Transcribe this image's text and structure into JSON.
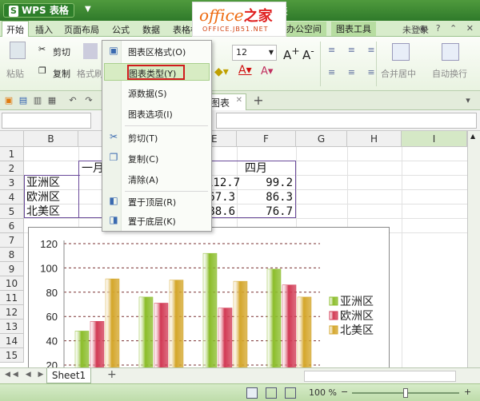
{
  "titlebar": {
    "app_name": "WPS 表格",
    "logo_letter": "S",
    "window_suffix": "表",
    "watermark_main": "office",
    "watermark_cn": "之家",
    "watermark_sub": "OFFICE.JB51.NET"
  },
  "menu_tabs": [
    "开始",
    "插入",
    "页面布局",
    "公式",
    "数据",
    "表格样式",
    "办公空间",
    "图表工具"
  ],
  "login_label": "未登录",
  "ribbon": {
    "cut_label": "剪切",
    "copy_label": "复制",
    "paste_label": "粘贴",
    "format_painter_label": "格式刷",
    "font_size": "12",
    "merge_label": "合并居中",
    "wrap_label": "自动换行"
  },
  "doc_tab_label": "图表",
  "context_menu": {
    "items": [
      {
        "label": "图表区格式(O)",
        "icon": "chart-format-icon"
      },
      {
        "label": "图表类型(Y)",
        "icon": ""
      },
      {
        "label": "源数据(S)",
        "icon": ""
      },
      {
        "label": "图表选项(I)",
        "icon": ""
      },
      {
        "label": "剪切(T)",
        "icon": "scissors-icon"
      },
      {
        "label": "复制(C)",
        "icon": "copy-icon"
      },
      {
        "label": "清除(A)",
        "icon": ""
      },
      {
        "label": "置于顶层(R)",
        "icon": "bring-front-icon"
      },
      {
        "label": "置于底层(K)",
        "icon": "send-back-icon"
      }
    ]
  },
  "grid": {
    "columns": [
      "B",
      "E",
      "F",
      "G",
      "H",
      "I"
    ],
    "rows": [
      "1",
      "2",
      "3",
      "4",
      "5",
      "6",
      "7",
      "8",
      "9",
      "10",
      "11",
      "12",
      "13",
      "14",
      "15"
    ],
    "header_month_1": "一月",
    "header_month_4": "四月",
    "regions": [
      "亚洲区",
      "欧洲区",
      "北美区"
    ],
    "col_e_values": [
      "112.7",
      "67.3",
      "88.6"
    ],
    "col_f_values": [
      "99.2",
      "86.3",
      "76.7"
    ]
  },
  "chart_data": {
    "type": "bar",
    "categories": [
      "",
      "",
      "",
      ""
    ],
    "series": [
      {
        "name": "亚洲区",
        "values": [
          48,
          76,
          112,
          99
        ]
      },
      {
        "name": "欧洲区",
        "values": [
          56,
          71,
          67,
          86
        ]
      },
      {
        "name": "北美区",
        "values": [
          91,
          90,
          89,
          76
        ]
      }
    ],
    "yticks": [
      "120",
      "100",
      "80",
      "60",
      "40",
      "20"
    ],
    "ylim": [
      20,
      120
    ],
    "grid": true,
    "legend": "right",
    "colors": [
      "#8bbd2a",
      "#d23a54",
      "#d4a62a"
    ]
  },
  "sheet_tab_label": "Sheet1",
  "status": {
    "zoom_label": "100 %"
  }
}
